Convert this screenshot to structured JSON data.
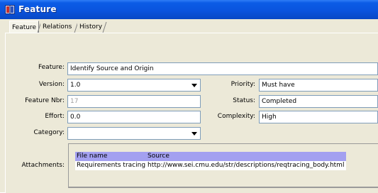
{
  "window": {
    "title": "Feature"
  },
  "tabs": [
    {
      "label": "Feature",
      "active": true
    },
    {
      "label": "Relations",
      "active": false
    },
    {
      "label": "History",
      "active": false
    }
  ],
  "form": {
    "feature": {
      "label": "Feature:",
      "value": "Identify Source and Origin"
    },
    "version": {
      "label": "Version:",
      "value": "1.0"
    },
    "feature_nbr": {
      "label": "Feature Nbr:",
      "value": "17"
    },
    "effort": {
      "label": "Effort:",
      "value": "0.0"
    },
    "category": {
      "label": "Category:",
      "value": ""
    },
    "priority": {
      "label": "Priority:",
      "value": "Must have"
    },
    "status": {
      "label": "Status:",
      "value": "Completed"
    },
    "complexity": {
      "label": "Complexity:",
      "value": "High"
    }
  },
  "attachments": {
    "label": "Attachments:",
    "columns": [
      "File name",
      "Source"
    ],
    "rows": [
      [
        "Requirements tracing",
        "http://www.sei.cmu.edu/str/descriptions/reqtracing_body.html"
      ]
    ]
  },
  "colors": {
    "titlebar": "#0a54de",
    "table_header": "#a3a0f0",
    "field_border": "#7f9db9",
    "panel_bg": "#ece9d8"
  },
  "icons": [
    "book-icon",
    "chevron-down-icon"
  ]
}
